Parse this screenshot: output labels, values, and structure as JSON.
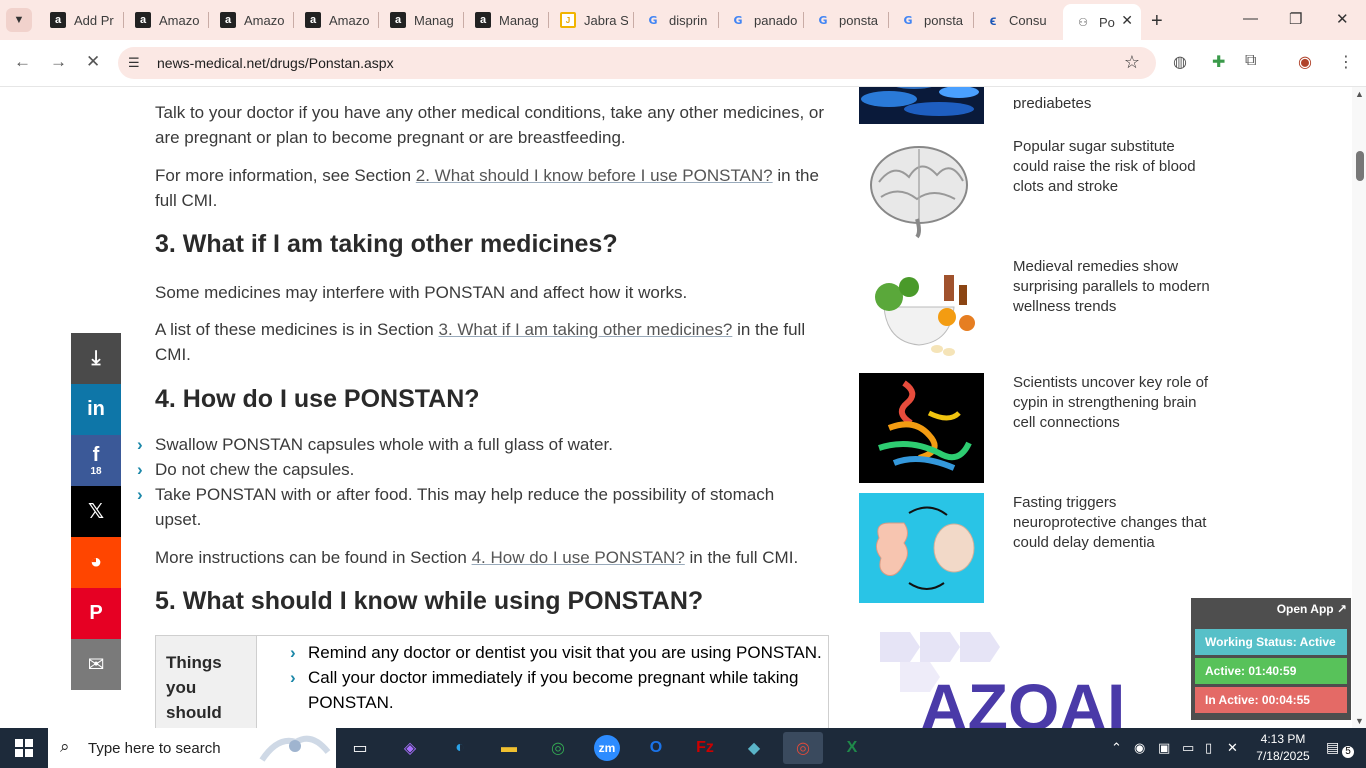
{
  "browser": {
    "tabs": [
      {
        "title": "Add Pr",
        "icon": "amazon-icon"
      },
      {
        "title": "Amazo",
        "icon": "amazon-icon"
      },
      {
        "title": "Amazo",
        "icon": "amazon-icon"
      },
      {
        "title": "Amazo",
        "icon": "amazon-icon"
      },
      {
        "title": "Manag",
        "icon": "amazon-icon"
      },
      {
        "title": "Manag",
        "icon": "amazon-icon"
      },
      {
        "title": "Jabra S",
        "icon": "jabra-icon"
      },
      {
        "title": "disprin",
        "icon": "google-icon"
      },
      {
        "title": "panado",
        "icon": "google-icon"
      },
      {
        "title": "ponsta",
        "icon": "google-icon"
      },
      {
        "title": "ponsta",
        "icon": "google-icon"
      },
      {
        "title": "Consu",
        "icon": "consumer-icon"
      },
      {
        "title": "Po",
        "icon": "news-medical-icon",
        "active": true
      }
    ],
    "url": "news-medical.net/drugs/Ponstan.aspx"
  },
  "article": {
    "p1": "Talk to your doctor if you have any other medical conditions, take any other medicines, or are pregnant or plan to become pregnant or are breastfeeding.",
    "p2_pre": "For more information, see Section ",
    "p2_link": "2. What should I know before I use PONSTAN?",
    "p2_post": " in the full CMI.",
    "h3": "3. What if I am taking other medicines?",
    "p3": "Some medicines may interfere with PONSTAN and affect how it works.",
    "p4_pre": "A list of these medicines is in Section ",
    "p4_link": "3. What if I am taking other medicines?",
    "p4_post": " in the full CMI.",
    "h4": "4. How do I use PONSTAN?",
    "bullets": [
      "Swallow PONSTAN capsules whole with a full glass of water.",
      "Do not chew the capsules.",
      "Take PONSTAN with or after food. This may help reduce the possibility of stomach upset."
    ],
    "p5_pre": "More instructions can be found in Section ",
    "p5_link": "4. How do I use PONSTAN?",
    "p5_post": " in the full CMI.",
    "h5": "5. What should I know while using PONSTAN?",
    "table_head": "Things you should do",
    "table_items": [
      "Remind any doctor or dentist you visit that you are using PONSTAN.",
      "Call your doctor immediately if you become pregnant while taking PONSTAN."
    ]
  },
  "share": {
    "facebook_count": "18"
  },
  "sidebar": {
    "partial_title": "prediabetes",
    "news": [
      {
        "title": "Popular sugar substitute could raise the risk of blood clots and stroke"
      },
      {
        "title": "Medieval remedies show surprising parallels to modern wellness trends"
      },
      {
        "title": "Scientists uncover key role of cypin in strengthening brain cell connections"
      },
      {
        "title": "Fasting triggers neuroprotective changes that could delay dementia"
      }
    ],
    "logo_text": "AZOAI"
  },
  "tracker": {
    "open_app": "Open App ↗",
    "working_status": "Working Status: Active",
    "active": "Active: 01:40:59",
    "inactive": "In Active: 00:04:55"
  },
  "taskbar": {
    "search_placeholder": "Type here to search",
    "time": "4:13 PM",
    "date": "7/18/2025",
    "notifications": "5"
  },
  "colors": {
    "tab_strip": "#fbe8e4",
    "linkedin": "#0e76a8",
    "facebook": "#3b5998",
    "x": "#000000",
    "reddit": "#ff4500",
    "pinterest": "#e60023",
    "email": "#7a7a7a",
    "download": "#4a4a4a",
    "working_status": "#57c0c8",
    "active": "#58c25a",
    "inactive": "#e46a66"
  }
}
